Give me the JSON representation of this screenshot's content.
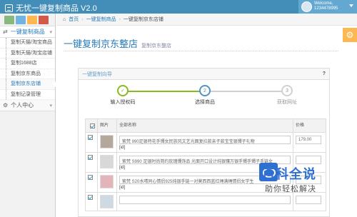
{
  "app": {
    "title": "无忧一键复制商品 V2.0",
    "welcome": "Welcome,",
    "username": "1234478995"
  },
  "shortcuts": [
    {
      "name": "shortcut-success",
      "color": "#87b87f"
    },
    {
      "name": "shortcut-info",
      "color": "#6fb3e0"
    },
    {
      "name": "shortcut-warning",
      "color": "#ffb752"
    },
    {
      "name": "shortcut-danger",
      "color": "#d15b47"
    }
  ],
  "sidebar": {
    "group": "一键复制商品",
    "items": [
      {
        "label": "复制天猫/淘宝商品"
      },
      {
        "label": "复制天猫/淘宝店铺"
      },
      {
        "label": "复制1688店"
      },
      {
        "label": "复制京东商品"
      },
      {
        "label": "复制京东店铺"
      },
      {
        "label": "复制记录管理"
      }
    ],
    "group2": "个人中心"
  },
  "breadcrumb": {
    "home": "首页",
    "section": "一键复制商品",
    "current": "一键复制京东店铺"
  },
  "page": {
    "title": "一键复制京东整店",
    "subtitle": "复制京东整店"
  },
  "wizard": {
    "title": "一键复制向导",
    "help": "?",
    "steps": [
      {
        "num": "1",
        "label": "输入授权码",
        "state": "done",
        "symbol": "✓"
      },
      {
        "num": "2",
        "label": "选择商品",
        "state": "current",
        "symbol": "2"
      },
      {
        "num": "3",
        "label": "获取网址",
        "state": "todo",
        "symbol": "3"
      }
    ]
  },
  "table": {
    "headers": {
      "image": "图片",
      "name": "全部名称",
      "price": "价格"
    },
    "rows": [
      {
        "name": "紫梵 990足银特花手镯女民族风文艺光面复拉款亲子款宝宝银镯子礼物",
        "id": "[id]",
        "price": "179.00",
        "checked": true,
        "thumb_color": "#b4a89c"
      },
      {
        "name": "紫梵 S990 足银时尚简约玫瑰镯饰品 光面开口设计纯银镶万银手镯手镯子手链女",
        "id": "[id]",
        "price": "",
        "checked": true,
        "thumb_color": "#d8d8d8"
      },
      {
        "name": "紫梵 S20水晴同心情侣925纯银手链一对莫西西蓝红绳满绳情侣女学生",
        "id": "[id]",
        "price": "",
        "checked": true,
        "thumb_color": "#e3b5ba"
      },
      {
        "name": "",
        "id": "",
        "price": "",
        "checked": true,
        "thumb_color": "#cfd9e3"
      }
    ]
  },
  "watermark": {
    "main": "百科全说",
    "sub": "助你轻松解决"
  }
}
